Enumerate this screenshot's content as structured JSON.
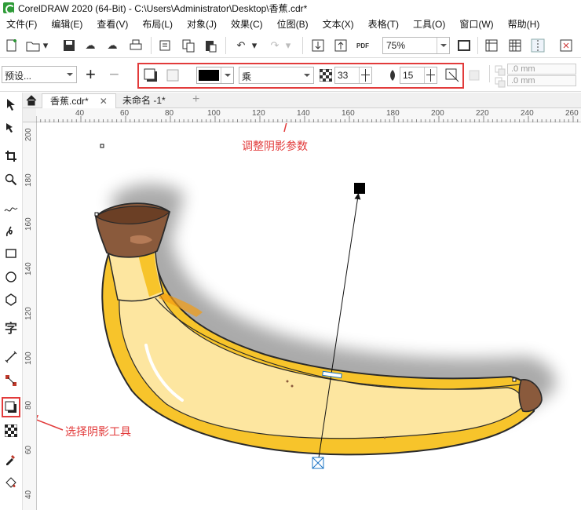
{
  "app": {
    "title": "CorelDRAW 2020 (64-Bit) - C:\\Users\\Administrator\\Desktop\\香蕉.cdr*"
  },
  "menu": [
    "文件(F)",
    "编辑(E)",
    "查看(V)",
    "布局(L)",
    "对象(J)",
    "效果(C)",
    "位图(B)",
    "文本(X)",
    "表格(T)",
    "工具(O)",
    "窗口(W)",
    "帮助(H)"
  ],
  "standard_toolbar": {
    "zoom": "75%",
    "pdf_label": "PDF"
  },
  "property_bar": {
    "preset": "预设...",
    "shadow_color": "#000000",
    "merge_mode": "乘",
    "opacity": "33",
    "feather": "15",
    "offset_x": ".0 mm",
    "offset_y": ".0 mm"
  },
  "tabs": [
    {
      "label": "香蕉.cdr*",
      "active": true
    },
    {
      "label": "未命名 -1*",
      "active": false
    }
  ],
  "ruler": {
    "h_labels": [
      "40",
      "60",
      "80",
      "100",
      "120",
      "140",
      "160",
      "180",
      "200",
      "220",
      "240",
      "260"
    ],
    "v_labels": [
      "200",
      "180",
      "160",
      "140",
      "120",
      "100",
      "80",
      "60",
      "40"
    ]
  },
  "annotations": {
    "adjust_shadow": "调整阴影参数",
    "select_shadow_tool": "选择阴影工具"
  },
  "colors": {
    "highlight_red": "#e23b3b",
    "banana_yellow": "#f7c42b",
    "banana_light": "#fde6a0",
    "stem_brown": "#8a5a3c"
  }
}
